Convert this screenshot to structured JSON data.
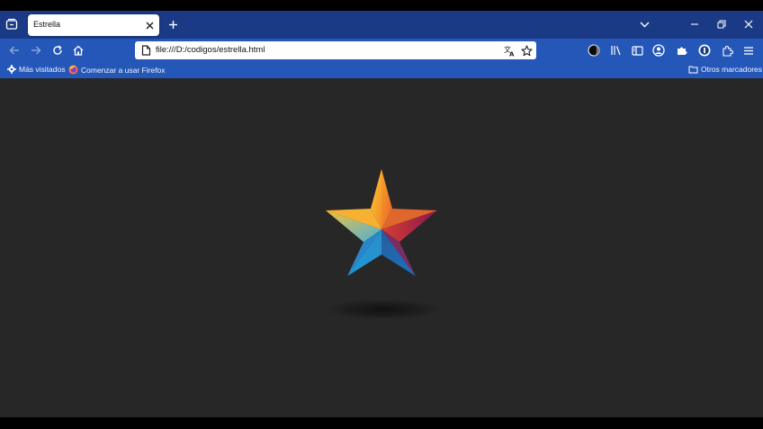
{
  "tab": {
    "title": "Estrella"
  },
  "urlbar": {
    "url": "file:///D:/codigos/estrella.html"
  },
  "bookmarks": {
    "items": [
      {
        "label": "Más visitados"
      },
      {
        "label": "Comenzar a usar Firefox"
      }
    ],
    "other": "Otros marcadores"
  },
  "colors": {
    "tabbar": "#1a3a86",
    "navbar": "#2457b8",
    "content_bg": "#272727",
    "star_top": "#f5a623",
    "star_right": "#b0174a",
    "star_bottom": "#1e8bd6"
  },
  "icons": [
    "tab-list-icon",
    "close-icon",
    "plus-icon",
    "chevron-down-icon",
    "minimize-icon",
    "restore-icon",
    "back-icon",
    "forward-icon",
    "reload-icon",
    "home-icon",
    "page-icon",
    "translate-icon",
    "bookmark-star-icon",
    "dark-mode-icon",
    "library-icon",
    "sidebar-icon",
    "account-icon",
    "extension-icon",
    "vpn-icon",
    "extensions-puzzle-icon",
    "menu-icon",
    "gear-icon",
    "firefox-icon",
    "folder-icon"
  ]
}
